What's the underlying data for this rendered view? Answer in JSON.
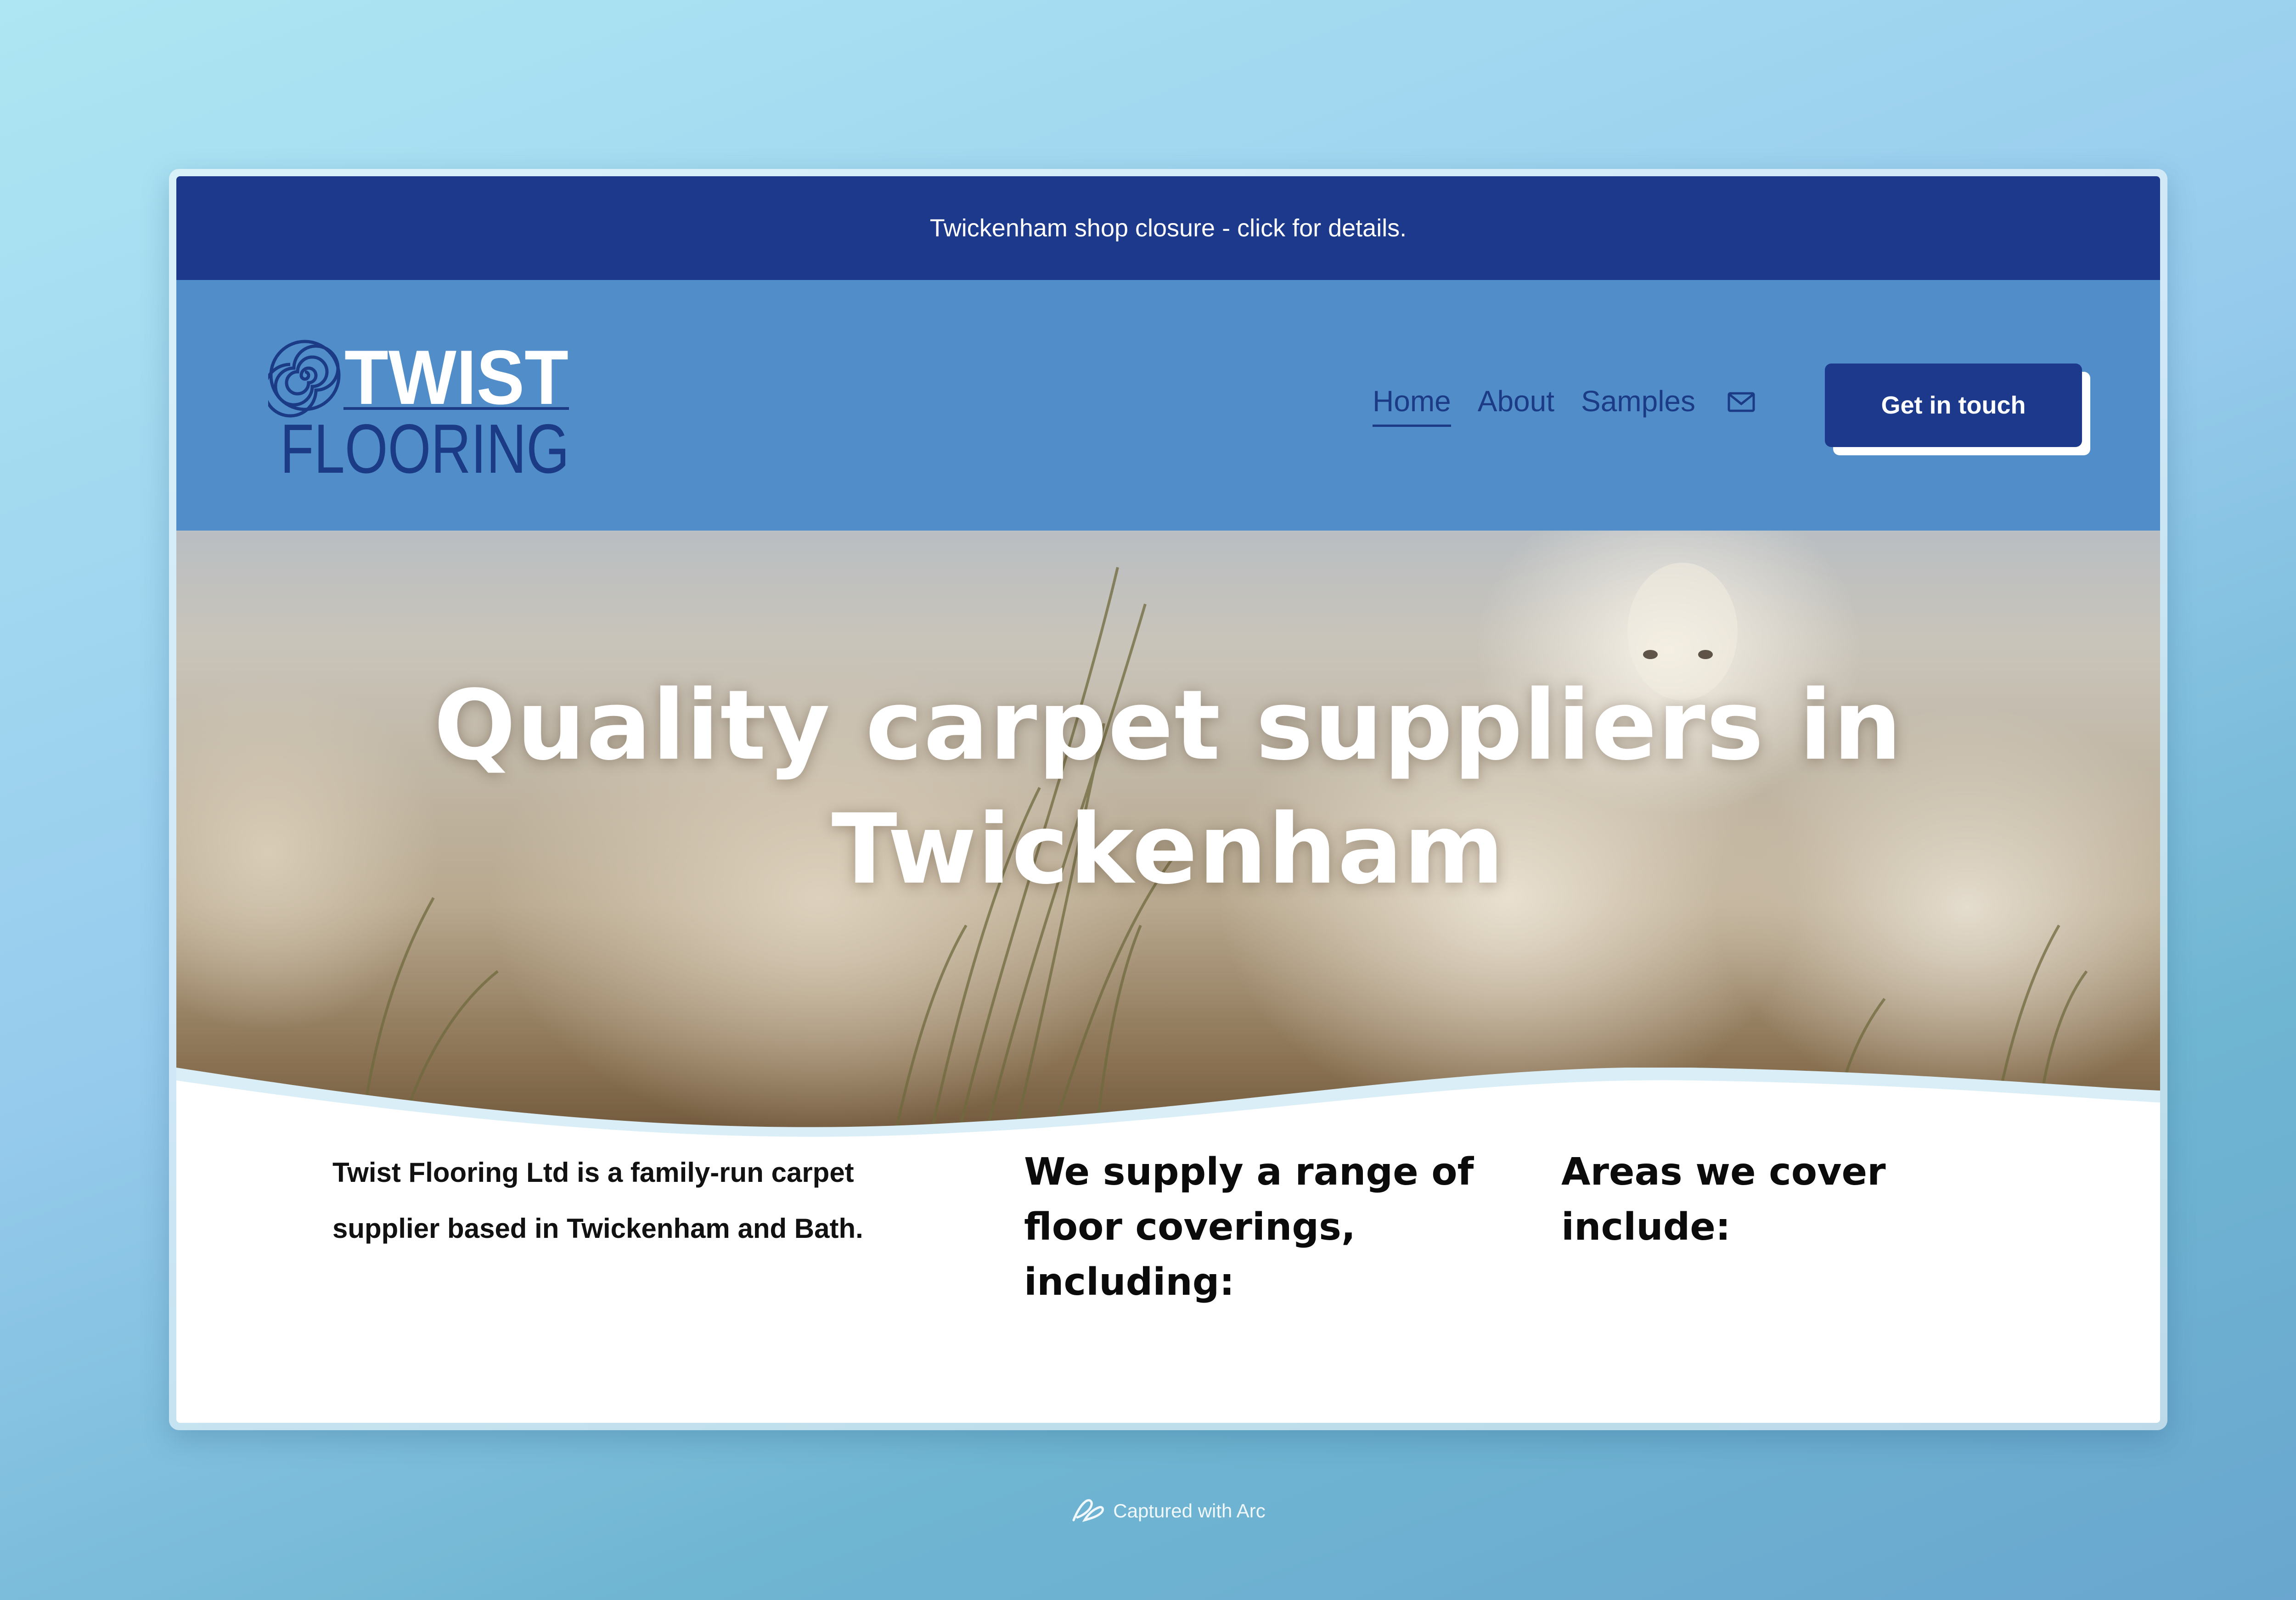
{
  "announcement": {
    "text": "Twickenham shop closure - click for details."
  },
  "logo": {
    "line1": "TWIST",
    "line2": "FLOORING"
  },
  "nav": {
    "items": [
      {
        "label": "Home",
        "active": true
      },
      {
        "label": "About",
        "active": false
      },
      {
        "label": "Samples",
        "active": false
      }
    ],
    "cta_label": "Get in touch"
  },
  "hero": {
    "title": "Quality carpet suppliers in Twickenham"
  },
  "content": {
    "intro": "Twist Flooring Ltd is a family-run carpet supplier based in Twickenham and Bath.",
    "heading_supply": "We supply a range of floor coverings, including:",
    "heading_areas": "Areas we cover include:"
  },
  "footer_badge": {
    "text": "Captured with Arc"
  },
  "colors": {
    "announcement_bg": "#1c398b",
    "header_bg": "#518ec9",
    "nav_text": "#1c3b86",
    "cta_bg": "#1c398b"
  },
  "icons": [
    "spiral-logo-icon",
    "mail-icon",
    "arc-logo-icon"
  ]
}
